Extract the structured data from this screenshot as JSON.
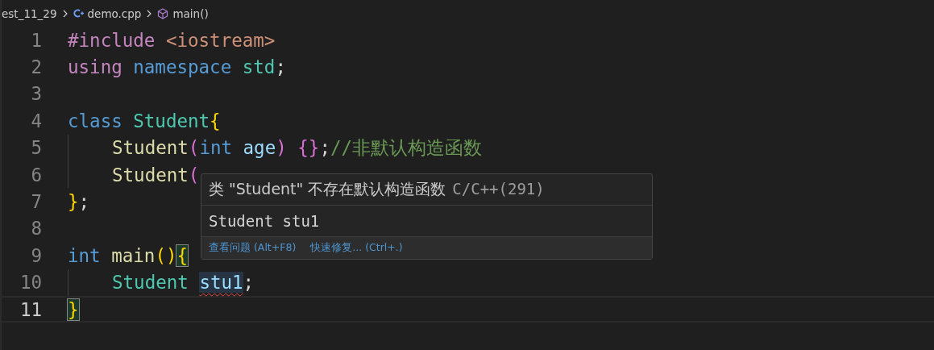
{
  "breadcrumb": [
    {
      "label": "est_11_29",
      "kind": "folder"
    },
    {
      "label": "demo.cpp",
      "kind": "file"
    },
    {
      "label": "main()",
      "kind": "symbol"
    }
  ],
  "lines": [
    {
      "number": "1",
      "current": false,
      "indented": false,
      "tokens": [
        {
          "t": "#include ",
          "kind": "keyword"
        },
        {
          "t": "<iostream>",
          "kind": "string"
        }
      ]
    },
    {
      "number": "2",
      "current": false,
      "indented": false,
      "tokens": [
        {
          "t": "using ",
          "kind": "keyword"
        },
        {
          "t": "namespace ",
          "kind": "storage"
        },
        {
          "t": "std",
          "kind": "type"
        },
        {
          "t": ";",
          "kind": "plain"
        }
      ]
    },
    {
      "number": "3",
      "current": false,
      "indented": false
    },
    {
      "number": "4",
      "current": false,
      "indented": false,
      "tokens": [
        {
          "t": "class ",
          "kind": "storage"
        },
        {
          "t": "Student",
          "kind": "type"
        },
        {
          "t": "{",
          "kind": "bracket1"
        }
      ]
    },
    {
      "number": "5",
      "current": false,
      "indented": true,
      "tokens": [
        {
          "t": "Student",
          "kind": "function"
        },
        {
          "t": "(",
          "kind": "bracket2"
        },
        {
          "t": "int ",
          "kind": "storage"
        },
        {
          "t": "age",
          "kind": "param"
        },
        {
          "t": ") ",
          "kind": "bracket2"
        },
        {
          "t": "{}",
          "kind": "bracket2"
        },
        {
          "t": ";",
          "kind": "plain"
        },
        {
          "t": "//非默认构造函数",
          "kind": "comment"
        }
      ]
    },
    {
      "number": "6",
      "current": false,
      "indented": true,
      "tokens": [
        {
          "t": "Student",
          "kind": "function"
        },
        {
          "t": "(",
          "kind": "bracket2"
        }
      ]
    },
    {
      "number": "7",
      "current": false,
      "indented": false,
      "tokens": [
        {
          "t": "}",
          "kind": "bracket1"
        },
        {
          "t": ";",
          "kind": "plain"
        }
      ]
    },
    {
      "number": "8",
      "current": false,
      "indented": false
    },
    {
      "number": "9",
      "current": false,
      "indented": false,
      "tokens": [
        {
          "t": "int ",
          "kind": "storage"
        },
        {
          "t": "main",
          "kind": "function"
        },
        {
          "t": "()",
          "kind": "bracket1"
        },
        {
          "t": "{",
          "kind": "bracket1",
          "matched": true
        }
      ]
    },
    {
      "number": "10",
      "current": false,
      "indented": true,
      "tokens": [
        {
          "t": "Student ",
          "kind": "type"
        },
        {
          "t": "stu1",
          "kind": "param",
          "error": true
        },
        {
          "t": ";",
          "kind": "plain"
        }
      ]
    },
    {
      "number": "11",
      "current": true,
      "indented": false,
      "tokens": [
        {
          "t": "}",
          "kind": "bracket1",
          "matched": true
        }
      ]
    }
  ],
  "hover": {
    "message": "类 \"Student\" 不存在默认构造函数",
    "source": "C/C++(291)",
    "code": "Student stu1",
    "actions": [
      "查看问题 (Alt+F8)",
      "快速修复... (Ctrl+.)"
    ]
  }
}
